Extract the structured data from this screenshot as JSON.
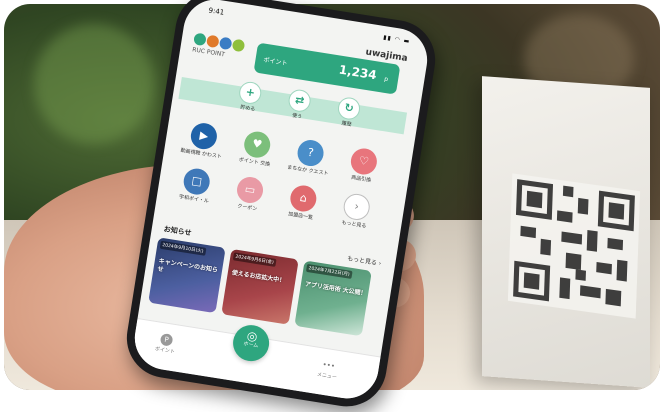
{
  "status": {
    "time": "9:41",
    "icons": "▮▮ ◠ ▬"
  },
  "brand": "uwajima",
  "logo": {
    "text": "RUC POINT",
    "colors": [
      "#2ea67f",
      "#e07a2b",
      "#3a7cc4",
      "#8fbf3c"
    ]
  },
  "points": {
    "label": "ポイント",
    "value": "1,234",
    "unit": "p"
  },
  "actions": [
    {
      "icon": "+",
      "label": "貯める"
    },
    {
      "icon": "⇄",
      "label": "使う"
    },
    {
      "icon": "↻",
      "label": "履歴"
    }
  ],
  "menu": [
    {
      "label": "動画視聴 かわスト",
      "icon": "▶",
      "color": "#1f62a8"
    },
    {
      "label": "ポイント 交換",
      "icon": "♥",
      "color": "#7cbf7b"
    },
    {
      "label": "まちなか クエスト",
      "icon": "?",
      "color": "#4a8ec9"
    },
    {
      "label": "商品引換",
      "icon": "♡",
      "color": "#e8757c"
    },
    {
      "label": "宇和ポイ・ル",
      "icon": "□",
      "color": "#3f78b8"
    },
    {
      "label": "クーポン",
      "icon": "▭",
      "color": "#e99aa5"
    },
    {
      "label": "加盟店一覧",
      "icon": "⌂",
      "color": "#e06a6e"
    },
    {
      "label": "もっと見る",
      "icon": "›",
      "color": "#bfbfbf"
    }
  ],
  "news": {
    "heading": "お知らせ",
    "more": "もっと見る ›",
    "items": [
      {
        "date": "2024年9月10日(火)",
        "title": "キャンペーンのお知らせ",
        "bg": "#2a3c6a"
      },
      {
        "date": "2024年9月6日(金)",
        "title": "使えるお店拡大中！",
        "bg": "#7a2a2e"
      },
      {
        "date": "2024年7月22日(月)",
        "title": "アプリ活用術 大公開！",
        "bg": "#4a8f6e"
      }
    ]
  },
  "tabbar": {
    "point": "ポイント",
    "home": "ホーム",
    "menu": "メニュー"
  },
  "colors": {
    "accent": "#2ea67f",
    "band": "#bfe6d5"
  }
}
